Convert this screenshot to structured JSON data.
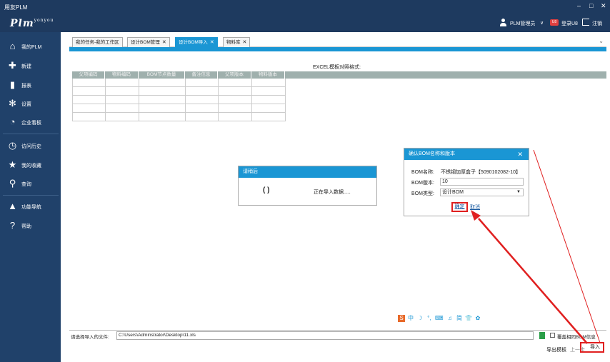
{
  "window": {
    "title": "用友PLM",
    "min": "–",
    "max": "□",
    "close": "✕"
  },
  "header": {
    "logo": "Plm",
    "logo_sub": "yonyou",
    "user": "PLM管理员",
    "user_dropdown": "∨",
    "login_u8": "登录U8",
    "logout": "注销",
    "badge": "U8"
  },
  "sidebar": {
    "items": [
      {
        "label": "我的PLM",
        "icon": "home-icon",
        "glyph": "⌂"
      },
      {
        "label": "新建",
        "icon": "new-icon",
        "glyph": "✚"
      },
      {
        "label": "报表",
        "icon": "report-icon",
        "glyph": "▮"
      },
      {
        "label": "设置",
        "icon": "gear-icon",
        "glyph": "✻"
      },
      {
        "label": "企业看板",
        "icon": "pie-icon",
        "glyph": "◔"
      },
      {
        "label": "访问历史",
        "icon": "history-icon",
        "glyph": "◷"
      },
      {
        "label": "我的收藏",
        "icon": "star-icon",
        "glyph": "★"
      },
      {
        "label": "查询",
        "icon": "search-icon",
        "glyph": "⚲"
      },
      {
        "label": "功能导航",
        "icon": "navigation-icon",
        "glyph": "▲"
      },
      {
        "label": "帮助",
        "icon": "help-icon",
        "glyph": "?"
      }
    ]
  },
  "tabs": [
    {
      "label": "我的任务-我的工作区",
      "closable": false
    },
    {
      "label": "设计BOM管理",
      "closable": true
    },
    {
      "label": "设计BOM导入",
      "closable": true,
      "active": true
    },
    {
      "label": "物料库",
      "closable": true
    }
  ],
  "tab_close": "✕",
  "collapse": "⌄",
  "excel": {
    "title": "EXCEL模板对照格式:",
    "columns": [
      "父项编码",
      "物料编码",
      "BOM节点数量",
      "备注信息",
      "父项版本",
      "物料版本"
    ]
  },
  "loading": {
    "title": "请稍后",
    "spinner": "( )",
    "message": "正在导入数据....."
  },
  "confirm": {
    "title": "确认BOM名称和版本",
    "close": "✕",
    "name_label": "BOM名称:",
    "name_value": "不锈钢加厚盒子【5090102082-10】",
    "version_label": "BOM版本:",
    "version_value": "10",
    "type_label": "BOM类型:",
    "type_value": "设计BOM",
    "ok": "确定",
    "cancel": "取消"
  },
  "toolbar": {
    "icons": [
      {
        "name": "sogou-icon",
        "glyph": "S"
      },
      {
        "name": "chinese-input-icon",
        "glyph": "中"
      },
      {
        "name": "moon-icon",
        "glyph": "☽"
      },
      {
        "name": "punctuation-icon",
        "glyph": "°,"
      },
      {
        "name": "keyboard-icon",
        "glyph": "⌨"
      },
      {
        "name": "voice-icon",
        "glyph": "♫"
      },
      {
        "name": "simplified-icon",
        "glyph": "简"
      },
      {
        "name": "shirt-icon",
        "glyph": "👕"
      },
      {
        "name": "settings-icon",
        "glyph": "✿"
      }
    ]
  },
  "bottom": {
    "file_label": "请选择导入的文件:",
    "file_path": "C:\\Users\\Adminstrator\\Desktop\\11.xls",
    "overwrite_label": "覆盖相同BOM信息",
    "export_template": "导出模板",
    "previous": "上一步",
    "import": "导入"
  },
  "colors": {
    "accent": "#1a96d4",
    "header": "#1e3a5f",
    "sidebar": "#20416a",
    "highlight": "#e02020"
  }
}
